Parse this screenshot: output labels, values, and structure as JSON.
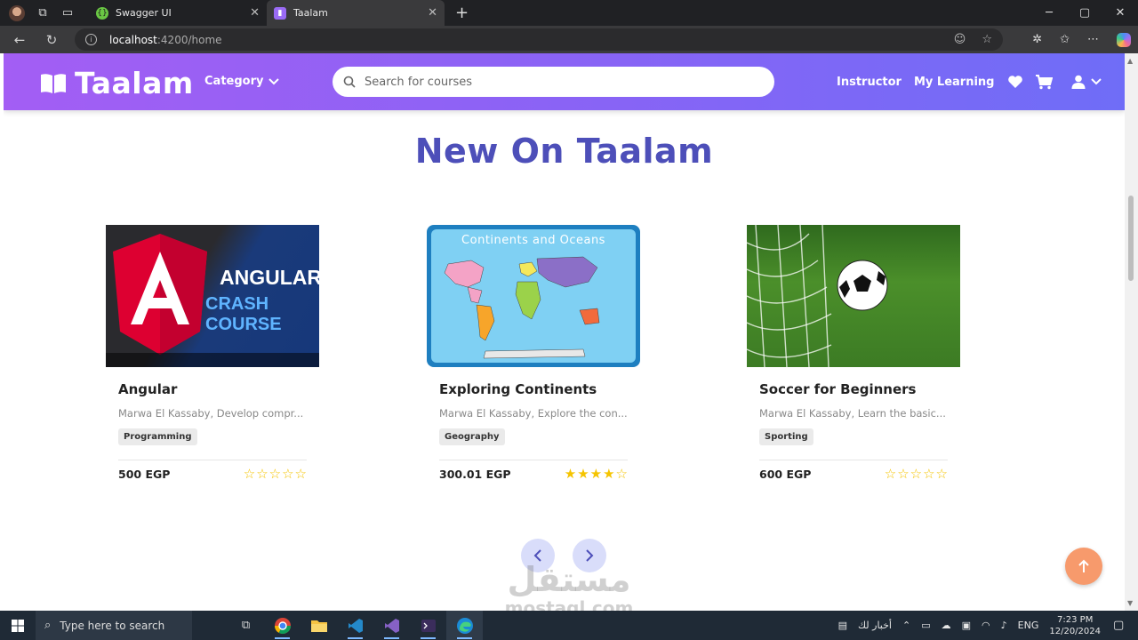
{
  "browser": {
    "tabs": [
      {
        "title": "Swagger UI",
        "active": false
      },
      {
        "title": "Taalam",
        "active": true
      }
    ],
    "url_host": "localhost",
    "url_path": ":4200/home"
  },
  "site": {
    "logo": "Taalam",
    "category_label": "Category",
    "search_placeholder": "Search for courses",
    "instructor_label": "Instructor",
    "my_learning_label": "My Learning"
  },
  "section": {
    "title": "New On Taalam"
  },
  "courses": [
    {
      "title": "Angular",
      "subtitle": "Marwa El Kassaby, Develop compr...",
      "tag": "Programming",
      "price": "500 EGP",
      "rating": 0,
      "thumb_text_1": "ANGULAR",
      "thumb_text_2": "CRASH COURSE"
    },
    {
      "title": "Exploring Continents",
      "subtitle": "Marwa El Kassaby, Explore the con...",
      "tag": "Geography",
      "price": "300.01 EGP",
      "rating": 4,
      "thumb_text_1": "Continents and Oceans"
    },
    {
      "title": "Soccer for Beginners",
      "subtitle": "Marwa El Kassaby, Learn the basic...",
      "tag": "Sporting",
      "price": "600 EGP",
      "rating": 0
    }
  ],
  "watermark": {
    "arabic": "مستقل",
    "english": "mostaql.com"
  },
  "taskbar": {
    "search_placeholder": "Type here to search",
    "news_label": "أخبار لك",
    "lang": "ENG",
    "time": "7:23 PM",
    "date": "12/20/2024"
  },
  "colors": {
    "brand_gradient_start": "#a35ef4",
    "brand_gradient_end": "#6f6df7",
    "title": "#4d4fb9",
    "star": "#f5c400",
    "to_top": "#f79a6c"
  }
}
